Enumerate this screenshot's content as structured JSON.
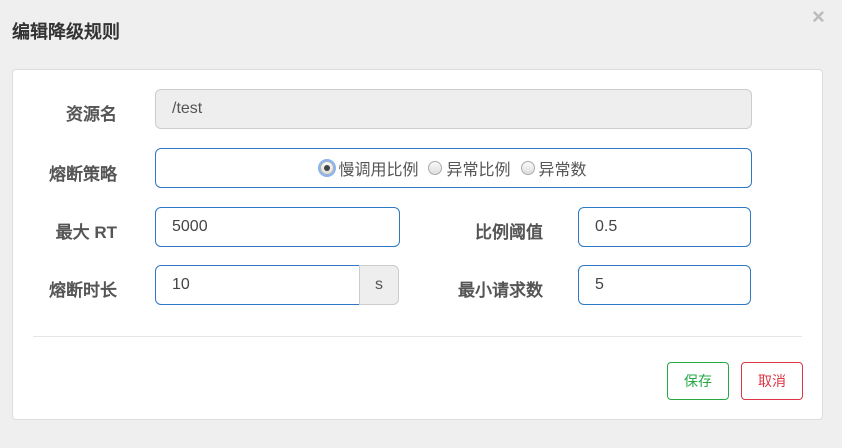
{
  "dialog": {
    "title": "编辑降级规则",
    "close": "×"
  },
  "form": {
    "resource": {
      "label": "资源名",
      "value": "/test"
    },
    "strategy": {
      "label": "熔断策略",
      "options": [
        "慢调用比例",
        "异常比例",
        "异常数"
      ],
      "selected": "慢调用比例"
    },
    "max_rt": {
      "label": "最大 RT",
      "value": "5000"
    },
    "ratio": {
      "label": "比例阈值",
      "value": "0.5"
    },
    "duration": {
      "label": "熔断时长",
      "value": "10",
      "unit": "s"
    },
    "min_requests": {
      "label": "最小请求数",
      "value": "5"
    }
  },
  "buttons": {
    "save": "保存",
    "cancel": "取消"
  },
  "colors": {
    "save": "#28a745",
    "cancel": "#dc3545",
    "input_border": "#2f78c4"
  }
}
